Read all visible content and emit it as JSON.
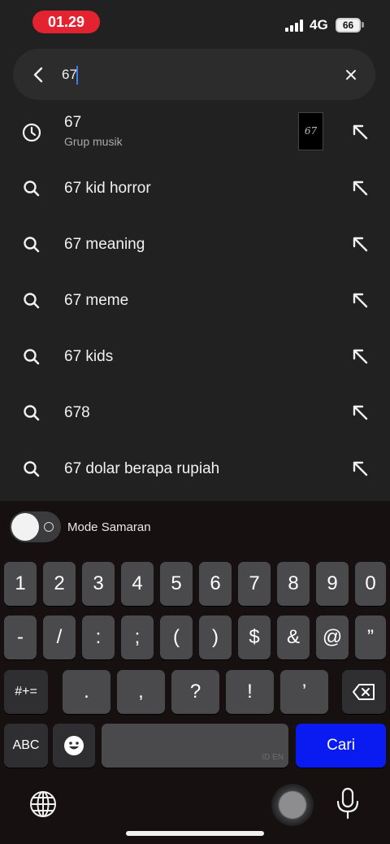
{
  "status_bar": {
    "time": "01.29",
    "network": "4G",
    "battery": "66"
  },
  "search": {
    "query": "67"
  },
  "suggestions": [
    {
      "text": "67",
      "subtitle": "Grup musik",
      "icon": "history-icon",
      "thumbnail_text": "67"
    },
    {
      "text": "67 kid horror",
      "icon": "search-icon"
    },
    {
      "text": "67 meaning",
      "icon": "search-icon"
    },
    {
      "text": "67 meme",
      "icon": "search-icon"
    },
    {
      "text": "67 kids",
      "icon": "search-icon"
    },
    {
      "text": "678",
      "icon": "search-icon"
    },
    {
      "text": "67 dolar berapa rupiah",
      "icon": "search-icon"
    }
  ],
  "keyboard": {
    "incognito_label": "Mode Samaran",
    "row1": [
      "1",
      "2",
      "3",
      "4",
      "5",
      "6",
      "7",
      "8",
      "9",
      "0"
    ],
    "row2": [
      "-",
      "/",
      ":",
      ";",
      "(",
      ")",
      "$",
      "&",
      "@",
      "”"
    ],
    "row3": [
      ".",
      ",",
      "?",
      "!",
      "’"
    ],
    "shift_label": "#+=",
    "abc_label": "ABC",
    "space_tag": "ID EN",
    "search_label": "Cari"
  },
  "colors": {
    "background": "#212121",
    "time_pill": "#e3232f",
    "search_key": "#0a1bf2",
    "caret": "#3f7df6"
  }
}
